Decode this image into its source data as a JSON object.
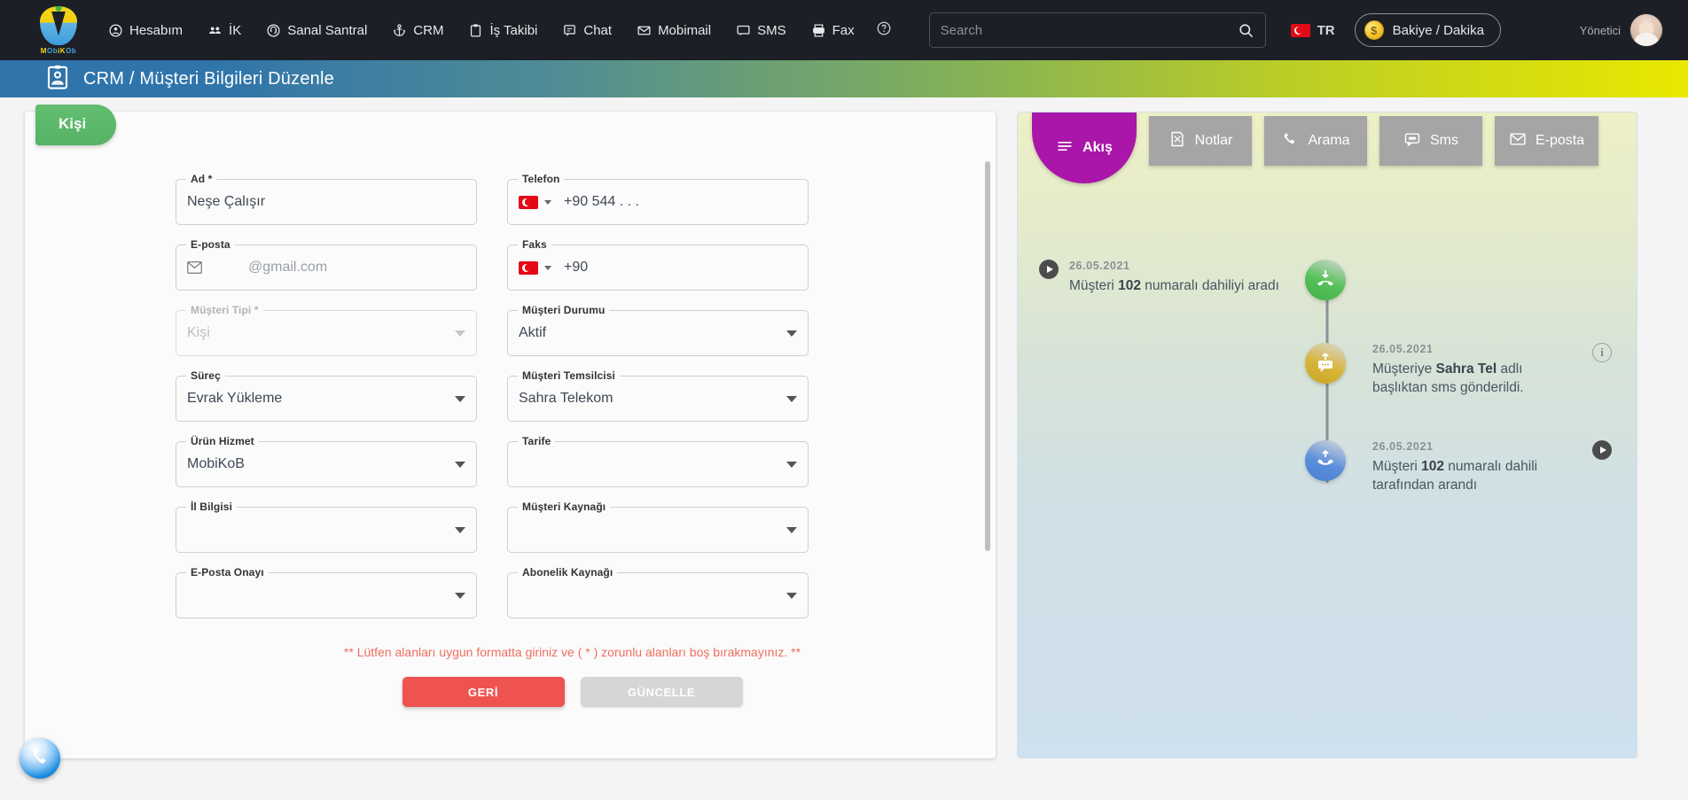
{
  "topnav": {
    "logo_text_a": "M",
    "logo_text_b": "Ob",
    "logo_text_c": "iK",
    "logo_text_d": "Ob",
    "items": [
      {
        "label": "Hesabım",
        "icon": "user-circle-icon"
      },
      {
        "label": "İK",
        "icon": "people-icon"
      },
      {
        "label": "Sanal Santral",
        "icon": "headset-icon"
      },
      {
        "label": "CRM",
        "icon": "anchor-icon"
      },
      {
        "label": "İş Takibi",
        "icon": "clipboard-icon"
      },
      {
        "label": "Chat",
        "icon": "chat-icon"
      },
      {
        "label": "Mobimail",
        "icon": "mail-icon"
      },
      {
        "label": "SMS",
        "icon": "sms-icon"
      },
      {
        "label": "Fax",
        "icon": "printer-icon"
      }
    ],
    "help_icon": "help-icon",
    "search": {
      "placeholder": "Search",
      "value": "",
      "icon": "search-icon"
    },
    "language": {
      "code": "TR",
      "flag": "turkey-flag-icon"
    },
    "balance": {
      "label": "Bakiye / Dakika",
      "icon": "coin-icon"
    },
    "user": {
      "role": "Yönetici",
      "avatar": "avatar-image"
    }
  },
  "breadcrumb": {
    "icon": "contact-card-icon",
    "title": "CRM / Müşteri Bilgileri Düzenle"
  },
  "form": {
    "tab_label": "Kişi",
    "fields": [
      {
        "label": "Ad *",
        "value": "Neşe Çalışır",
        "type": "text",
        "disabled": false,
        "col": "left"
      },
      {
        "label": "Telefon",
        "value": "+90 544 . . .",
        "type": "phone",
        "disabled": false,
        "col": "right",
        "flag": "turkey-flag-icon"
      },
      {
        "label": "E-posta",
        "value": "@gmail.com",
        "type": "email",
        "disabled": false,
        "col": "left",
        "icon": "envelope-icon"
      },
      {
        "label": "Faks",
        "value": "+90",
        "type": "phone",
        "disabled": false,
        "col": "right",
        "flag": "turkey-flag-icon"
      },
      {
        "label": "Müşteri Tipi *",
        "value": "Kişi",
        "type": "select",
        "disabled": true,
        "col": "left"
      },
      {
        "label": "Müşteri Durumu",
        "value": "Aktif",
        "type": "select",
        "disabled": false,
        "col": "right"
      },
      {
        "label": "Süreç",
        "value": "Evrak Yükleme",
        "type": "select",
        "disabled": false,
        "col": "left"
      },
      {
        "label": "Müşteri Temsilcisi",
        "value": "Sahra Telekom",
        "type": "select",
        "disabled": false,
        "col": "right"
      },
      {
        "label": "Ürün Hizmet",
        "value": "MobiKoB",
        "type": "select",
        "disabled": false,
        "col": "left"
      },
      {
        "label": "Tarife",
        "value": "",
        "type": "select",
        "disabled": false,
        "col": "right"
      },
      {
        "label": "İl Bilgisi",
        "value": "",
        "type": "select",
        "disabled": false,
        "col": "left"
      },
      {
        "label": "Müşteri Kaynağı",
        "value": "",
        "type": "select",
        "disabled": false,
        "col": "right"
      },
      {
        "label": "E-Posta Onayı",
        "value": "",
        "type": "select",
        "disabled": false,
        "col": "left"
      },
      {
        "label": "Abonelik Kaynağı",
        "value": "",
        "type": "select",
        "disabled": false,
        "col": "right"
      }
    ],
    "warning": "** Lütfen alanları uygun formatta giriniz ve ( * ) zorunlu alanları boş bırakmayınız. **",
    "back_button": "GERİ",
    "update_button": "GÜNCELLE"
  },
  "panel": {
    "tabs": [
      {
        "label": "Akış",
        "icon": "menu-lines-icon",
        "active": true
      },
      {
        "label": "Notlar",
        "icon": "note-icon",
        "active": false
      },
      {
        "label": "Arama",
        "icon": "phone-icon",
        "active": false
      },
      {
        "label": "Sms",
        "icon": "chat-bubble-icon",
        "active": false
      },
      {
        "label": "E-posta",
        "icon": "envelope-icon",
        "active": false
      }
    ],
    "timeline": [
      {
        "date": "26.05.2021",
        "text_prefix": "Müşteri ",
        "text_bold": "102",
        "text_suffix": " numaralı dahiliyi aradı",
        "side": "left",
        "badge": "incoming-call-icon",
        "badge_color": "#4cb850",
        "action": "play-button"
      },
      {
        "date": "26.05.2021",
        "text_prefix": "Müşteriye ",
        "text_bold": "Sahra Tel",
        "text_suffix": " adlı başlıktan sms gönderildi.",
        "side": "right",
        "badge": "outgoing-sms-icon",
        "badge_color": "#d0ae2f",
        "action": "info-button"
      },
      {
        "date": "26.05.2021",
        "text_prefix": "Müşteri ",
        "text_bold": "102",
        "text_suffix": " numaralı dahili tarafından arandı",
        "side": "right",
        "badge": "outgoing-call-icon",
        "badge_color": "#5388d6",
        "action": "play-button"
      }
    ]
  },
  "floating": {
    "call_button_icon": "phone-handset-icon"
  }
}
